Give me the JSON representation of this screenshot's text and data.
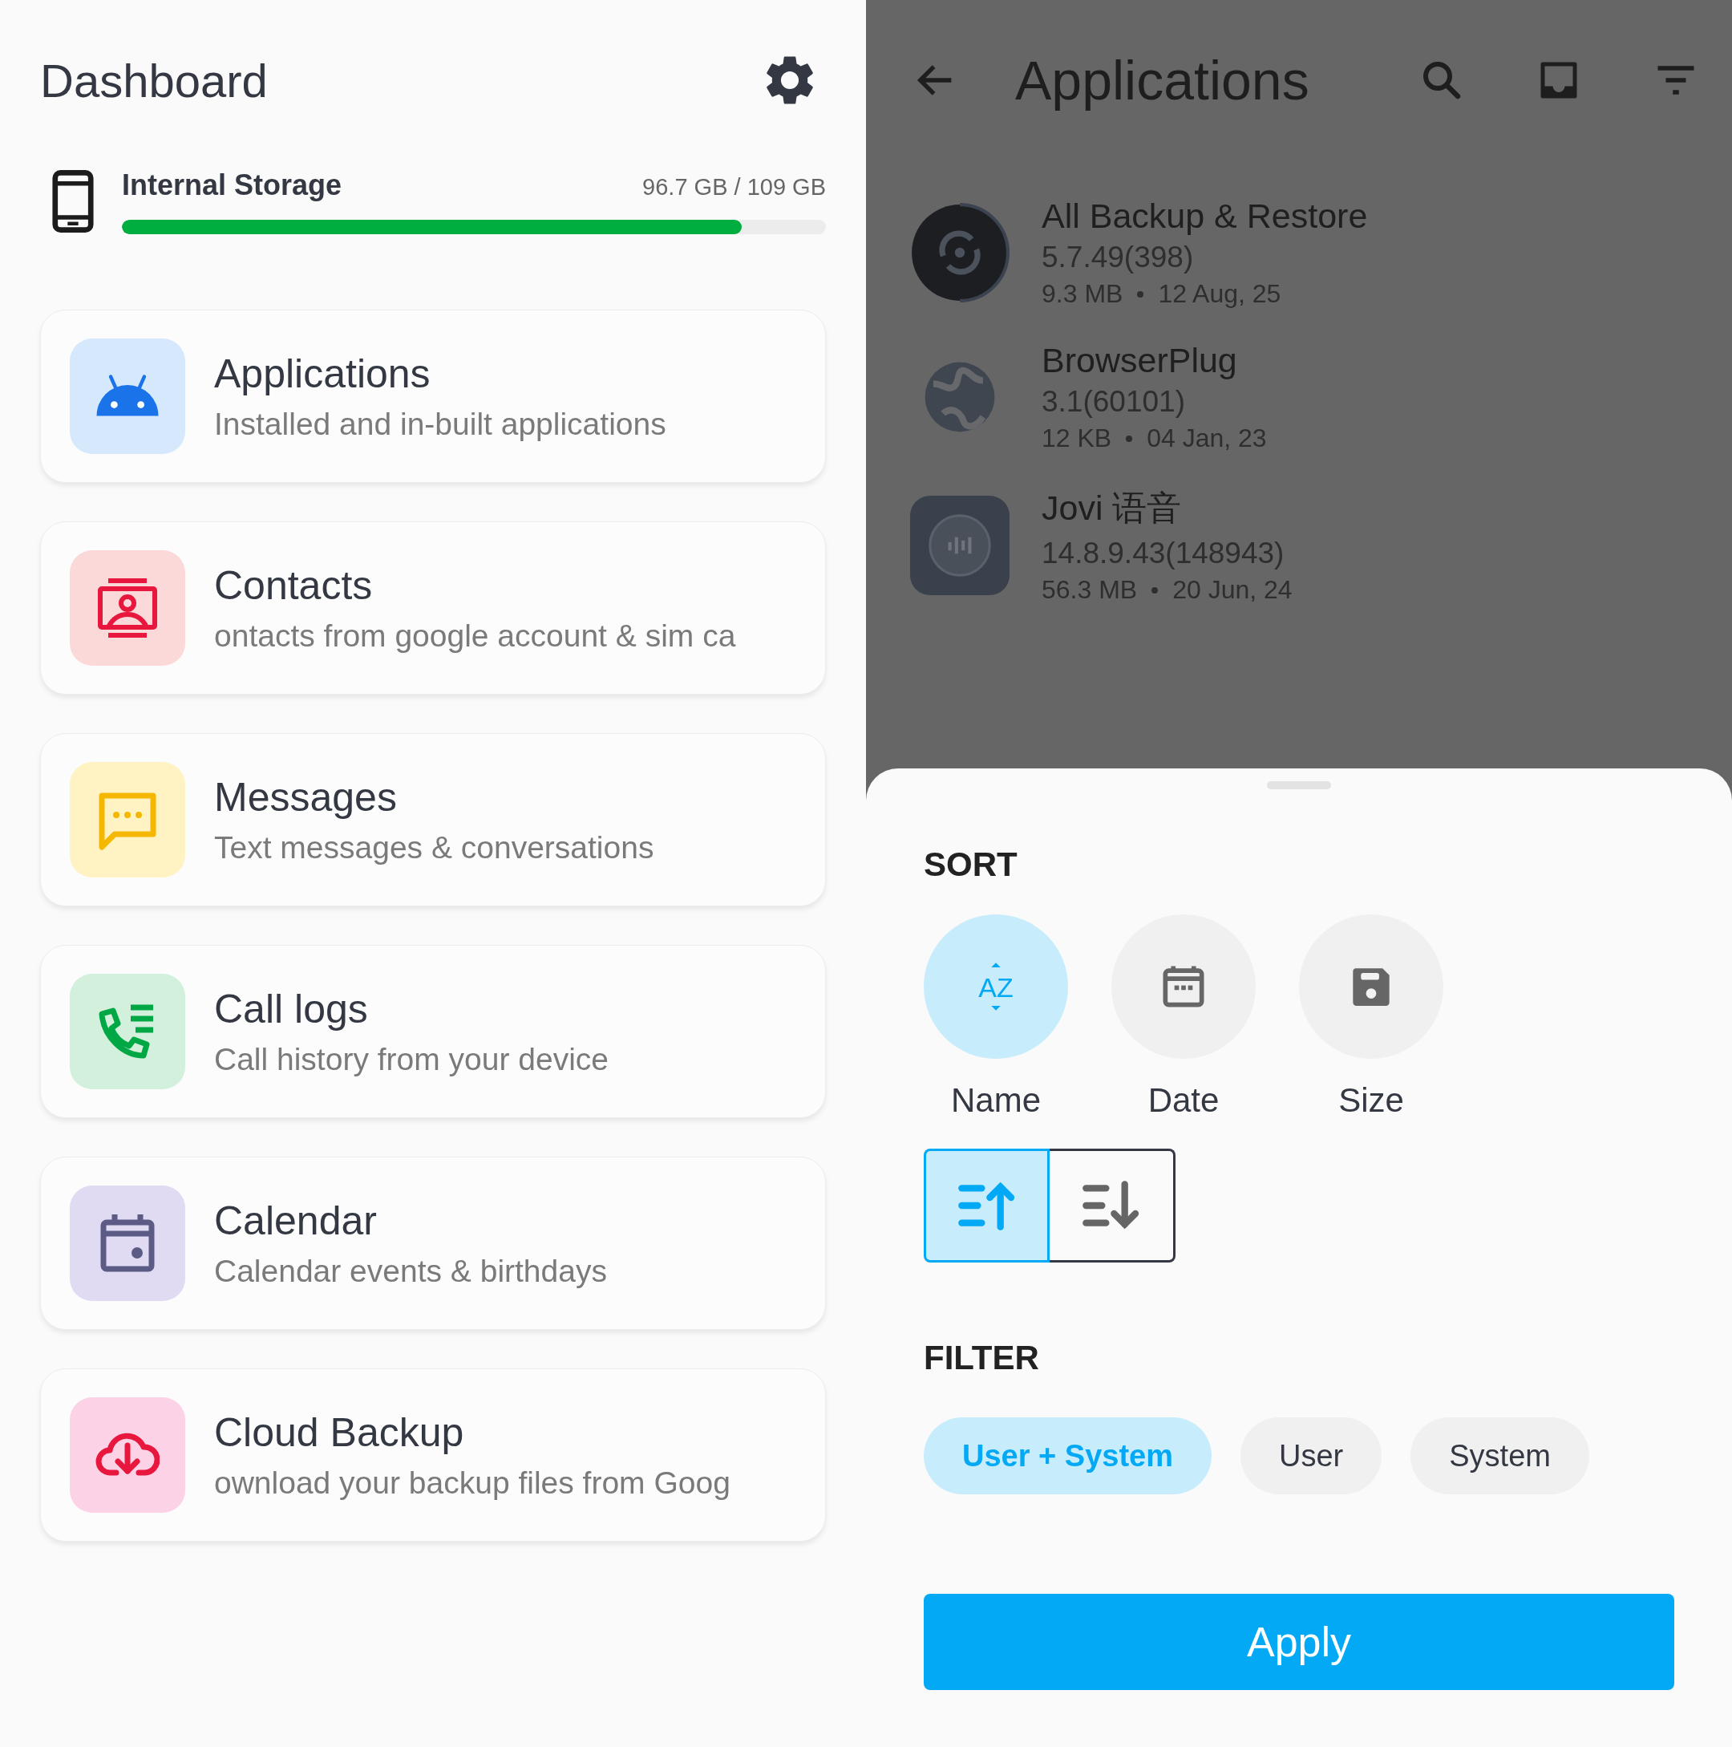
{
  "dashboard": {
    "title": "Dashboard",
    "storage": {
      "label": "Internal Storage",
      "usage": "96.7 GB / 109 GB",
      "level": 0.88
    },
    "cards": [
      {
        "kind": "applications",
        "title": "Applications",
        "subtitle": "Installed and in-built applications"
      },
      {
        "kind": "contacts",
        "title": "Contacts",
        "subtitle": "ontacts from google account & sim ca"
      },
      {
        "kind": "messages",
        "title": "Messages",
        "subtitle": "Text messages & conversations"
      },
      {
        "kind": "call_logs",
        "title": "Call logs",
        "subtitle": "Call history from your device"
      },
      {
        "kind": "calendar",
        "title": "Calendar",
        "subtitle": "Calendar events & birthdays"
      },
      {
        "kind": "cloud_backup",
        "title": "Cloud Backup",
        "subtitle": "ownload your backup files from Goog"
      }
    ]
  },
  "applications_screen": {
    "title": "Applications",
    "apps": [
      {
        "kind": "sync",
        "name": "All Backup & Restore",
        "version": "5.7.49(398)",
        "size": "9.3 MB",
        "date": "12 Aug, 25"
      },
      {
        "kind": "globe",
        "name": "BrowserPlug",
        "version": "3.1(60101)",
        "size": "12 KB",
        "date": "04 Jan, 23"
      },
      {
        "kind": "voice",
        "name": "Jovi 语音",
        "version": "14.8.9.43(148943)",
        "size": "56.3 MB",
        "date": "20 Jun, 24"
      }
    ]
  },
  "sort_sheet": {
    "sort_heading": "SORT",
    "sort_options": [
      {
        "kind": "name",
        "icon_text": "AZ",
        "label": "Name",
        "selected": true
      },
      {
        "kind": "date",
        "label": "Date",
        "selected": false
      },
      {
        "kind": "size",
        "label": "Size",
        "selected": false
      }
    ],
    "order": [
      {
        "kind": "ascending",
        "selected": true
      },
      {
        "kind": "descending",
        "selected": false
      }
    ],
    "filter_heading": "FILTER",
    "filters": [
      {
        "label": "User + System",
        "selected": true
      },
      {
        "label": "User",
        "selected": false
      },
      {
        "label": "System",
        "selected": false
      }
    ],
    "apply_button": "Apply"
  }
}
